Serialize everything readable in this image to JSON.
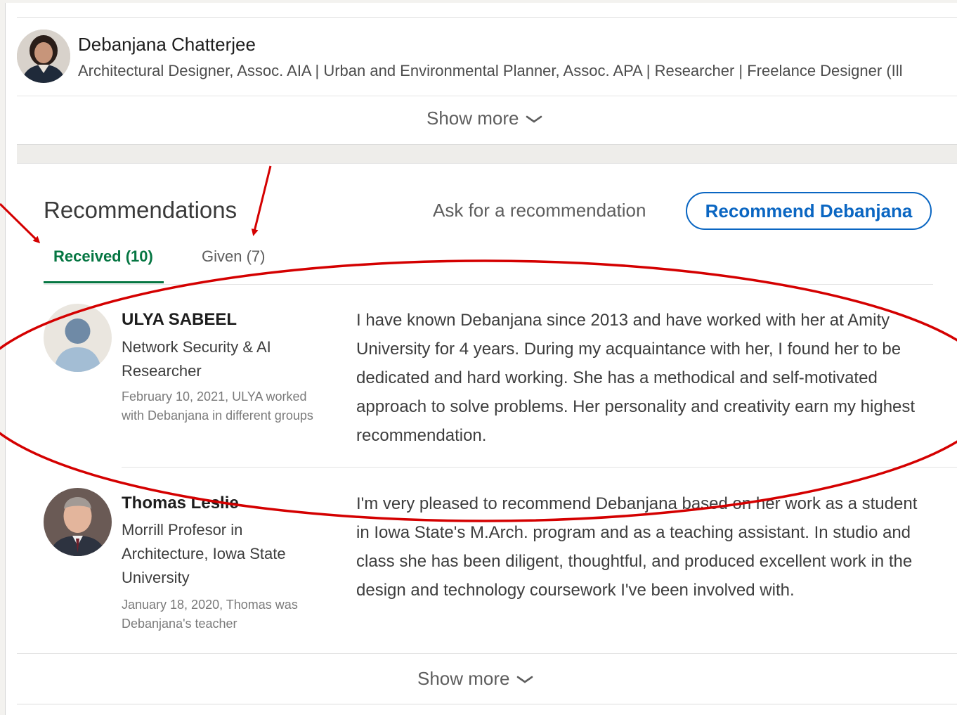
{
  "profile": {
    "name": "Debanjana Chatterjee",
    "headline": "Architectural Designer, Assoc. AIA | Urban and Environmental Planner, Assoc. APA | Researcher | Freelance Designer (Ill",
    "show_more_label": "Show more"
  },
  "recommendations": {
    "title": "Recommendations",
    "ask_label": "Ask for a recommendation",
    "recommend_button": "Recommend Debanjana",
    "tabs": [
      {
        "label": "Received (10)",
        "active": true
      },
      {
        "label": "Given (7)",
        "active": false
      }
    ],
    "items": [
      {
        "name": "ULYA SABEEL",
        "role": "Network Security & AI Researcher",
        "meta": "February 10, 2021, ULYA worked with Debanjana in different groups",
        "text": "I have known Debanjana since 2013 and have worked with her at Amity University for 4 years. During my acquaintance with her, I found her to be dedicated and hard working. She has a methodical and self-motivated approach to solve problems. Her personality and creativity earn my highest recommendation."
      },
      {
        "name": "Thomas Leslie",
        "role": "Morrill Profesor in Architecture, Iowa State University",
        "meta": "January 18, 2020, Thomas was Debanjana's teacher",
        "text": "I'm very pleased to recommend Debanjana based on her work as a student in Iowa State's M.Arch. program and as a teaching assistant. In studio and class she has been diligent, thoughtful, and produced excellent work in the design and technology coursework I've been involved with."
      }
    ],
    "show_more_label": "Show more"
  },
  "colors": {
    "accent_blue": "#0a66c2",
    "active_tab_green": "#057642",
    "annotation_red": "#d40000"
  }
}
